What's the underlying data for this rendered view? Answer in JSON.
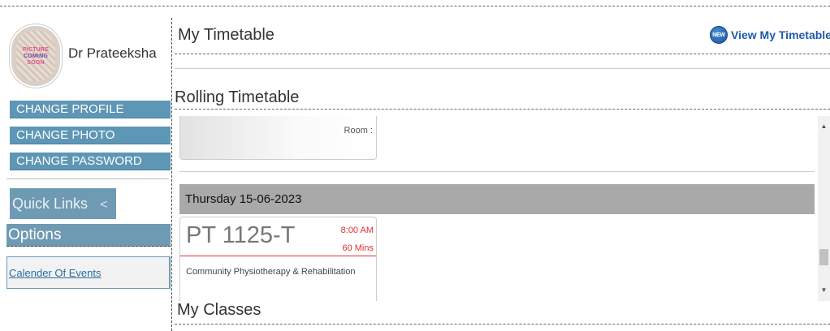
{
  "profile": {
    "name": "Dr Prateeksha",
    "avatar_text": [
      "PICTURE",
      "COMING",
      "SOON"
    ]
  },
  "sidebar": {
    "buttons": [
      "CHANGE PROFILE",
      "CHANGE PHOTO",
      "CHANGE PASSWORD"
    ],
    "quick_links": "Quick Links",
    "quick_links_chevron": "<",
    "options": "Options",
    "calendar_link": "Calender Of Events"
  },
  "main": {
    "title": "My Timetable",
    "view_link": "View My Timetable",
    "new_badge": "NEW",
    "rolling_title": "Rolling Timetable",
    "room_label": "Room :",
    "day_header": "Thursday 15-06-2023",
    "class": {
      "code": "PT 1125-T",
      "time": "8:00 AM",
      "duration": "60 Mins",
      "name": "Community Physiotherapy & Rehabilitation"
    },
    "classes_title": "My Classes"
  },
  "colors": {
    "sidebar_button": "#5e96b5",
    "sidebar_panel": "#6f9ab3",
    "day_header": "#a9a9a9",
    "time_red": "#e03030",
    "link_blue": "#1e5aa8"
  },
  "icons": {
    "new_badge": "new-badge-icon",
    "chevron": "chevron-left-icon",
    "scroll_up": "arrow-up-icon",
    "scroll_down": "arrow-down-icon"
  }
}
